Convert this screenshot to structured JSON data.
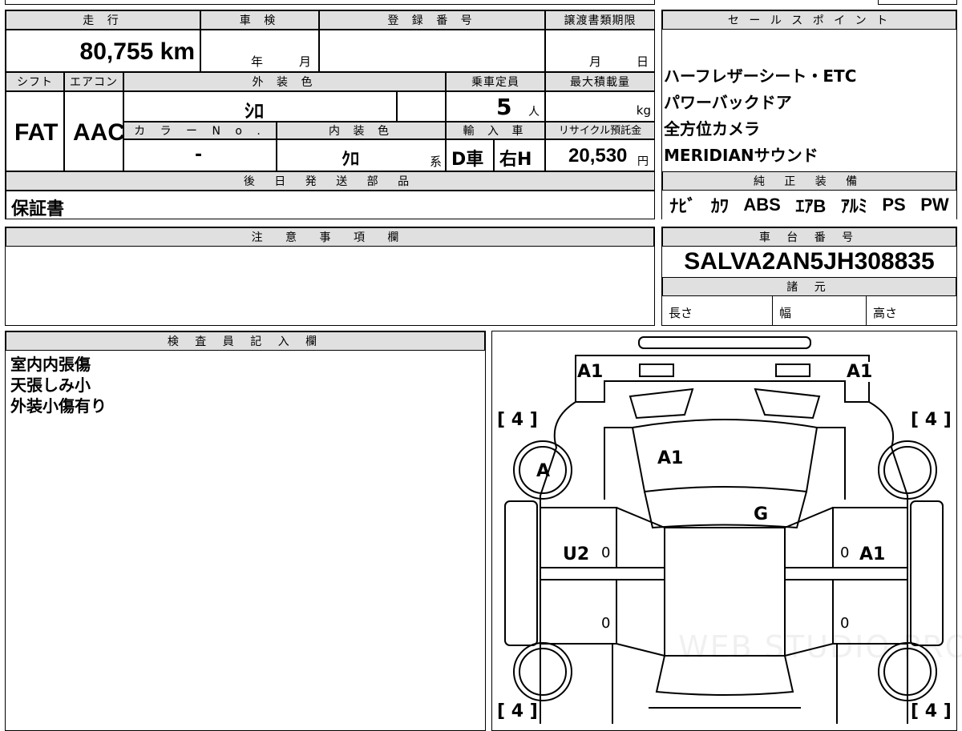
{
  "labels": {
    "mileage": "走 行",
    "inspection": "車 検",
    "registration": "登 録 番 号",
    "transfer_deadline": "譲渡書類期限",
    "sales_point": "セ ー ル ス ポ イ ン ト",
    "shift": "シフト",
    "aircon": "エアコン",
    "exterior_color": "外 装 色",
    "capacity": "乗車定員",
    "max_load": "最大積載量",
    "color_no": "カ ラ ー N o .",
    "interior_color": "内 装 色",
    "import": "輸 入 車",
    "recycle": "リサイクル預託金",
    "later_parts": "後 日 発 送 部 品",
    "genuine_equipment": "純 正 装 備",
    "notes": "注 意 事 項 欄",
    "chassis": "車 台 番 号",
    "specs": "諸 元",
    "length": "長さ",
    "width": "幅",
    "height": "高さ",
    "inspector": "検 査 員 記 入 欄"
  },
  "values": {
    "mileage": "80,755 km",
    "year_unit": "年",
    "month_unit": "月",
    "deadline_month": "月",
    "deadline_day": "日",
    "shift": "FAT",
    "aircon": "AAC",
    "exterior_color": "ｼﾛ",
    "capacity": "5",
    "capacity_unit": "人",
    "load_unit": "kg",
    "color_no": "-",
    "interior_color": "ｸﾛ",
    "interior_suffix": "系",
    "import_type": "D車",
    "handle": "右H",
    "recycle": "20,530",
    "recycle_unit": "円",
    "later_parts": "保証書",
    "chassis": "SALVA2AN5JH308835"
  },
  "sales_points": [
    "ハーフレザーシート・ETC",
    "パワーバックドア",
    "全方位カメラ",
    "MERIDIANサウンド"
  ],
  "equipment": [
    "ﾅﾋﾞ",
    "ｶﾜ",
    "ABS",
    "ｴｱB",
    "ｱﾙﾐ",
    "PS",
    "PW"
  ],
  "inspector_notes": [
    "室内内張傷",
    "天張しみ小",
    "外装小傷有り"
  ],
  "diagram_marks": {
    "front_left": "A1",
    "front_right": "A1",
    "windshield": "A1",
    "left_front_wheel": "A",
    "hood_g": "G",
    "left_door": "U2",
    "right_door": "A1",
    "zero": "0",
    "tyre": "4",
    "watermark": "WEB STUDIO PRO"
  }
}
